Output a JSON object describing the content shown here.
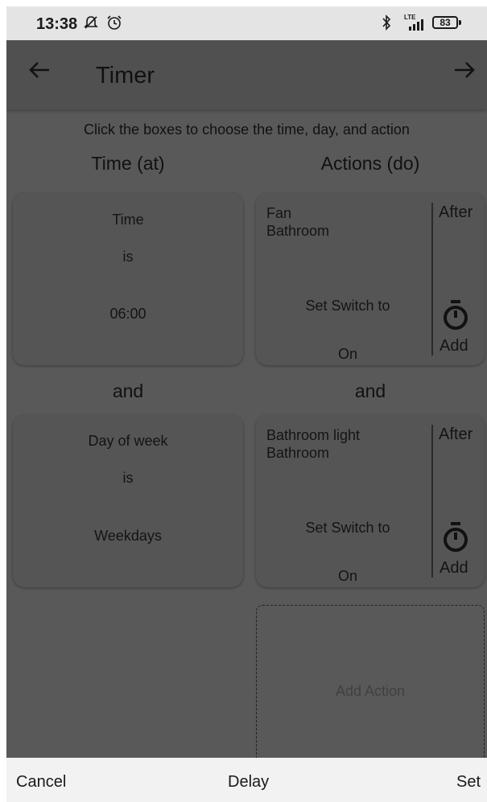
{
  "status_bar": {
    "time": "13:38",
    "icons": [
      "notification-off-icon",
      "alarm-icon",
      "bluetooth-icon",
      "lte-signal-icon"
    ],
    "network": "LTE",
    "battery": "83"
  },
  "app_bar": {
    "title": "Timer",
    "back_icon": "arrow-left-icon",
    "forward_icon": "arrow-right-icon"
  },
  "instructions": "Click the boxes to choose the time, day, and action",
  "columns": {
    "conditions_header": "Time (at)",
    "actions_header": "Actions (do)"
  },
  "conditions": [
    {
      "subject": "Time",
      "operator": "is",
      "value": "06:00"
    },
    {
      "subject": "Day of week",
      "operator": "is",
      "value": "Weekdays"
    }
  ],
  "connector": "and",
  "actions": [
    {
      "device": "Fan",
      "room": "Bathroom",
      "command": "Set Switch to",
      "state": "On",
      "after_label": "After",
      "add_label": "Add"
    },
    {
      "device": "Bathroom light",
      "room": "Bathroom",
      "command": "Set Switch to",
      "state": "On",
      "after_label": "After",
      "add_label": "Add"
    }
  ],
  "add_action_label": "Add Action",
  "bottom_bar": {
    "cancel": "Cancel",
    "delay": "Delay",
    "set": "Set"
  }
}
